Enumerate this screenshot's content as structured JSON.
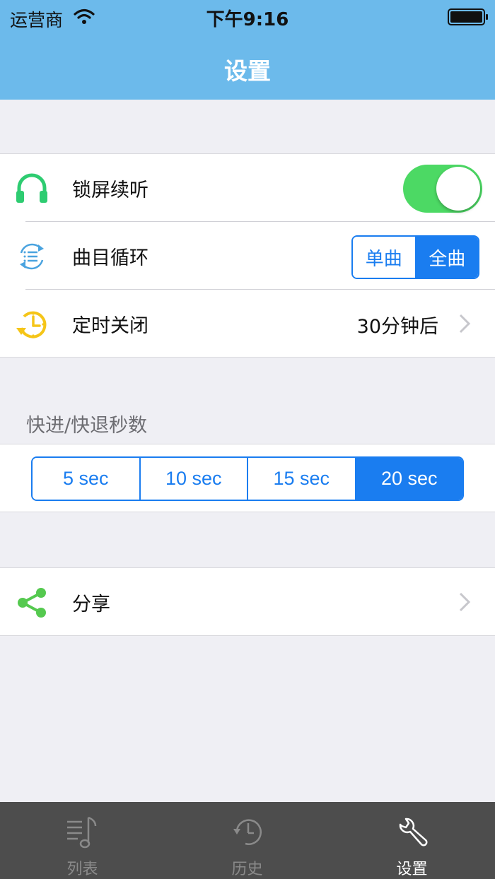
{
  "status_bar": {
    "carrier": "运营商",
    "time": "下午9:16"
  },
  "nav": {
    "title": "设置"
  },
  "settings": {
    "lock_screen": {
      "label": "锁屏续听",
      "icon": "headphones-icon",
      "enabled": true
    },
    "loop": {
      "label": "曲目循环",
      "icon": "repeat-icon",
      "options": [
        "单曲",
        "全曲"
      ],
      "selected": "全曲"
    },
    "timer": {
      "label": "定时关闭",
      "icon": "timer-icon",
      "value": "30分钟后"
    }
  },
  "seek": {
    "section_title": "快进/快退秒数",
    "options": [
      "5 sec",
      "10 sec",
      "15 sec",
      "20 sec"
    ],
    "selected": "20 sec"
  },
  "share": {
    "label": "分享",
    "icon": "share-icon"
  },
  "tabbar": {
    "tabs": [
      {
        "label": "列表",
        "icon": "music-list-icon",
        "active": false
      },
      {
        "label": "历史",
        "icon": "history-clock-icon",
        "active": false
      },
      {
        "label": "设置",
        "icon": "wrench-icon",
        "active": true
      }
    ]
  },
  "colors": {
    "header_bg": "#6cbaeb",
    "accent_blue": "#1a7df0",
    "toggle_on": "#4cd964",
    "headphones": "#2ecc71",
    "timer": "#f5c518",
    "share": "#55c94f",
    "tabbar_bg": "#4d4d4d"
  }
}
